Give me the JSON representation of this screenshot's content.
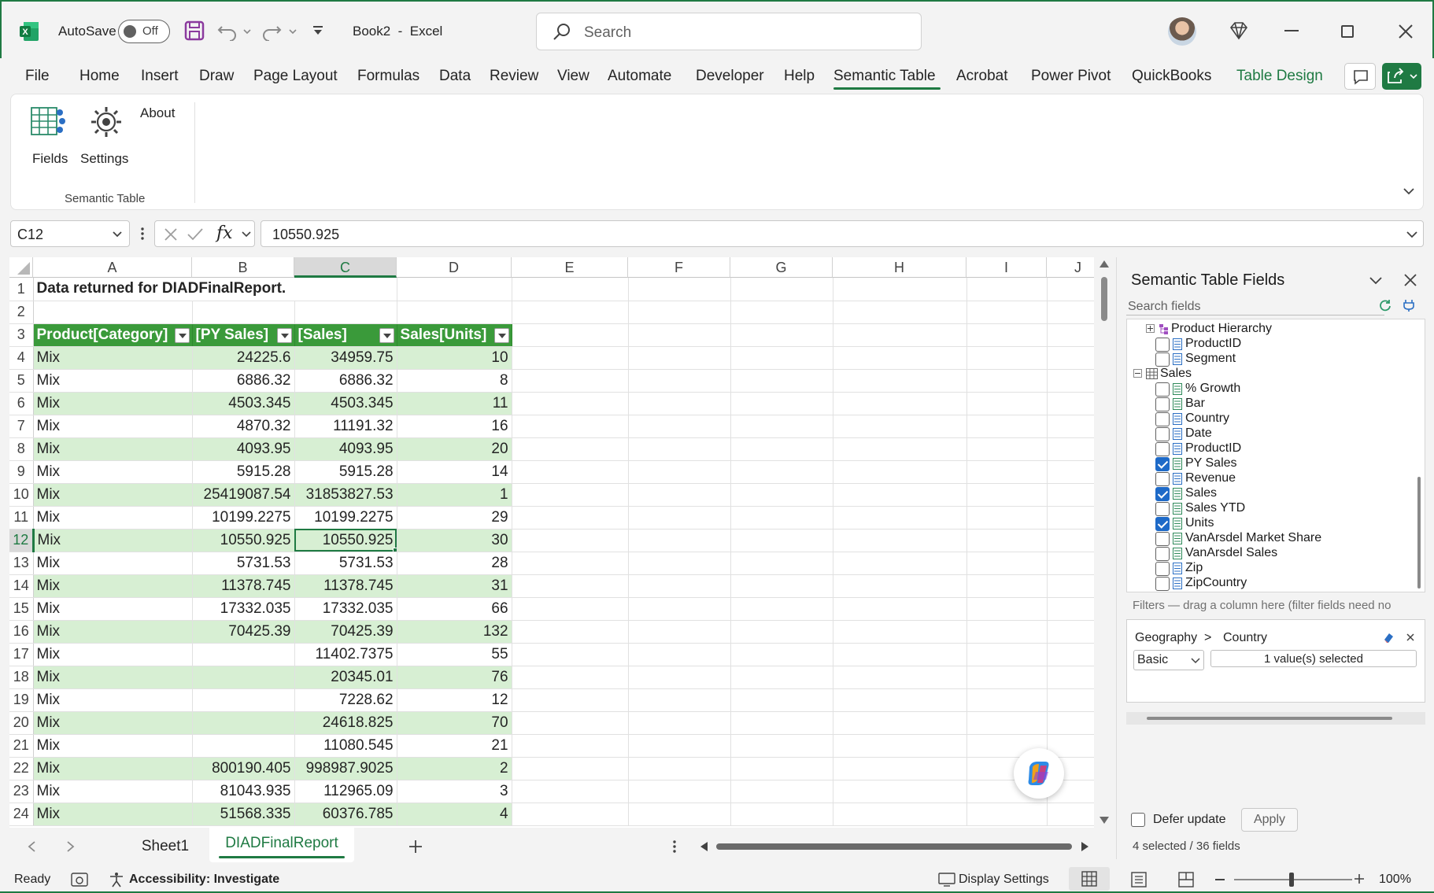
{
  "titlebar": {
    "autosave_label": "AutoSave",
    "autosave_state": "Off",
    "doc_title": "Book2  -  Excel",
    "search_placeholder": "Search"
  },
  "menu": {
    "tabs": [
      "File",
      "Home",
      "Insert",
      "Draw",
      "Page Layout",
      "Formulas",
      "Data",
      "Review",
      "View",
      "Automate",
      "Developer",
      "Help",
      "Semantic Table",
      "Acrobat",
      "Power Pivot",
      "QuickBooks",
      "Table Design"
    ],
    "active": "Semantic Table"
  },
  "ribbon": {
    "fields": "Fields",
    "settings": "Settings",
    "about": "About",
    "group_label": "Semantic Table"
  },
  "formula_bar": {
    "name_box": "C12",
    "fx": "fx",
    "value": "10550.925"
  },
  "grid": {
    "columns": [
      "A",
      "B",
      "C",
      "D",
      "E",
      "F",
      "G",
      "H",
      "I",
      "J"
    ],
    "title_cell": "Data returned for DIADFinalReport.",
    "headers": [
      "Product[Category]",
      "[PY Sales]",
      "[Sales]",
      "Sales[Units]"
    ],
    "rows": [
      [
        "Mix",
        "24225.6",
        "34959.75",
        "10"
      ],
      [
        "Mix",
        "6886.32",
        "6886.32",
        "8"
      ],
      [
        "Mix",
        "4503.345",
        "4503.345",
        "11"
      ],
      [
        "Mix",
        "4870.32",
        "11191.32",
        "16"
      ],
      [
        "Mix",
        "4093.95",
        "4093.95",
        "20"
      ],
      [
        "Mix",
        "5915.28",
        "5915.28",
        "14"
      ],
      [
        "Mix",
        "25419087.54",
        "31853827.53",
        "1"
      ],
      [
        "Mix",
        "10199.2275",
        "10199.2275",
        "29"
      ],
      [
        "Mix",
        "10550.925",
        "10550.925",
        "30"
      ],
      [
        "Mix",
        "5731.53",
        "5731.53",
        "28"
      ],
      [
        "Mix",
        "11378.745",
        "11378.745",
        "31"
      ],
      [
        "Mix",
        "17332.035",
        "17332.035",
        "66"
      ],
      [
        "Mix",
        "70425.39",
        "70425.39",
        "132"
      ],
      [
        "Mix",
        "",
        "11402.7375",
        "55"
      ],
      [
        "Mix",
        "",
        "20345.01",
        "76"
      ],
      [
        "Mix",
        "",
        "7228.62",
        "12"
      ],
      [
        "Mix",
        "",
        "24618.825",
        "70"
      ],
      [
        "Mix",
        "",
        "11080.545",
        "21"
      ],
      [
        "Mix",
        "800190.405",
        "998987.9025",
        "2"
      ],
      [
        "Mix",
        "81043.935",
        "112965.09",
        "3"
      ],
      [
        "Mix",
        "51568.335",
        "60376.785",
        "4"
      ]
    ],
    "row_numbers": [
      "1",
      "2",
      "3",
      "4",
      "5",
      "6",
      "7",
      "8",
      "9",
      "10",
      "11",
      "12",
      "13",
      "14",
      "15",
      "16",
      "17",
      "18",
      "19",
      "20",
      "21",
      "22",
      "23",
      "24"
    ],
    "selected_cell": "C12"
  },
  "pane": {
    "title": "Semantic Table Fields",
    "search_placeholder": "Search fields",
    "tree": [
      {
        "label": "Product Hierarchy",
        "type": "hierarchy",
        "checked": false
      },
      {
        "label": "ProductID",
        "type": "column",
        "checked": false
      },
      {
        "label": "Segment",
        "type": "column",
        "checked": false
      },
      {
        "label": "Sales",
        "type": "table",
        "checked": false
      },
      {
        "label": "% Growth",
        "type": "measure",
        "checked": false
      },
      {
        "label": "Bar",
        "type": "measure",
        "checked": false
      },
      {
        "label": "Country",
        "type": "column",
        "checked": false
      },
      {
        "label": "Date",
        "type": "column",
        "checked": false
      },
      {
        "label": "ProductID",
        "type": "column",
        "checked": false
      },
      {
        "label": "PY Sales",
        "type": "measure",
        "checked": true
      },
      {
        "label": "Revenue",
        "type": "column",
        "checked": false
      },
      {
        "label": "Sales",
        "type": "measure",
        "checked": true
      },
      {
        "label": "Sales YTD",
        "type": "measure",
        "checked": false
      },
      {
        "label": "Units",
        "type": "measure",
        "checked": true
      },
      {
        "label": "VanArsdel Market Share",
        "type": "measure",
        "checked": false
      },
      {
        "label": "VanArsdel Sales",
        "type": "measure",
        "checked": false
      },
      {
        "label": "Zip",
        "type": "column",
        "checked": false
      },
      {
        "label": "ZipCountry",
        "type": "column",
        "checked": false
      }
    ],
    "filters_hint": "Filters — drag a column here (filter fields need no",
    "filter": {
      "path_table": "Geography",
      "path_sep": ">",
      "path_field": "Country",
      "mode": "Basic",
      "value": "1 value(s) selected"
    },
    "defer_label": "Defer update",
    "apply_label": "Apply",
    "summary": "4 selected / 36 fields"
  },
  "sheets": {
    "tabs": [
      "Sheet1",
      "DIADFinalReport"
    ],
    "active": "DIADFinalReport"
  },
  "status": {
    "ready": "Ready",
    "accessibility": "Accessibility: Investigate",
    "display_settings": "Display Settings",
    "zoom": "100%"
  },
  "colors": {
    "excel_green": "#1f7a43",
    "table_header": "#3a9a3a",
    "table_band": "#d7efd3",
    "checkbox_blue": "#1e6ac8"
  }
}
